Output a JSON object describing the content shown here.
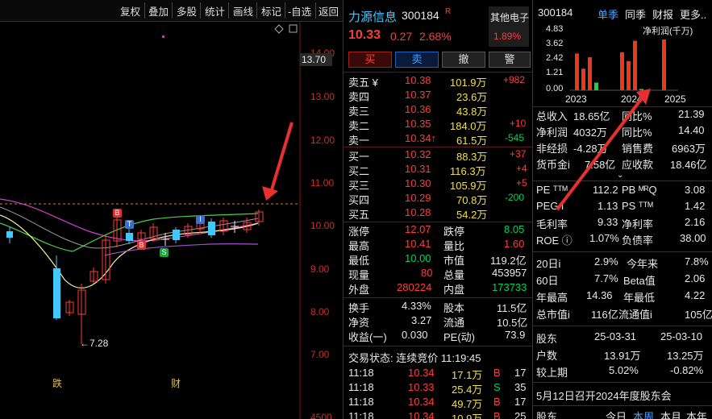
{
  "toolbar": {
    "items": [
      "复权",
      "叠加",
      "多股",
      "统计",
      "画线",
      "标记",
      "-自选",
      "返回"
    ]
  },
  "chart": {
    "price_labels": [
      "14.00",
      "13.00",
      "12.00",
      "11.00",
      "10.00",
      "9.00",
      "8.00",
      "7.00",
      "4500"
    ],
    "current_price_tag": "13.70",
    "low_label": "←7.28",
    "markers": {
      "b1": "B",
      "b2": "B",
      "t": "T",
      "i": "I",
      "s": "S"
    },
    "bottom_labels": [
      "跌",
      "财"
    ]
  },
  "quote": {
    "name": "力源信息",
    "code": "300184",
    "code_badge": "R",
    "sector": "其他电子",
    "sector_change": "1.89%",
    "price": "10.33",
    "change": "0.27",
    "change_pct": "2.68%",
    "buttons": [
      "买",
      "卖",
      "撤",
      "警"
    ],
    "asks": [
      {
        "label": "卖五 ¥",
        "price": "10.38",
        "vol": "101.9万",
        "delta": "+982",
        "delta_color": "red"
      },
      {
        "label": "卖四",
        "price": "10.37",
        "vol": "23.6万",
        "delta": "",
        "delta_color": "red"
      },
      {
        "label": "卖三",
        "price": "10.36",
        "vol": "43.8万",
        "delta": "",
        "delta_color": "red"
      },
      {
        "label": "卖二",
        "price": "10.35",
        "vol": "184.0万",
        "delta": "+10",
        "delta_color": "red"
      },
      {
        "label": "卖一",
        "price": "10.34↑",
        "vol": "61.5万",
        "delta": "-545",
        "delta_color": "green"
      }
    ],
    "bids": [
      {
        "label": "买一",
        "price": "10.32",
        "vol": "88.3万",
        "delta": "+37",
        "delta_color": "red"
      },
      {
        "label": "买二",
        "price": "10.31",
        "vol": "116.3万",
        "delta": "+4",
        "delta_color": "red"
      },
      {
        "label": "买三",
        "price": "10.30",
        "vol": "105.9万",
        "delta": "+5",
        "delta_color": "red"
      },
      {
        "label": "买四",
        "price": "10.29",
        "vol": "70.8万",
        "delta": "-200",
        "delta_color": "green"
      },
      {
        "label": "买五",
        "price": "10.28",
        "vol": "54.2万",
        "delta": "",
        "delta_color": "red"
      }
    ],
    "stats": [
      {
        "l1": "涨停",
        "v1": "12.07",
        "c1": "red",
        "l2": "跌停",
        "v2": "8.05",
        "c2": "green"
      },
      {
        "l1": "最高",
        "v1": "10.41",
        "c1": "red",
        "l2": "量比",
        "v2": "1.60",
        "c2": "red"
      },
      {
        "l1": "最低",
        "v1": "10.00",
        "c1": "green",
        "l2": "市值",
        "v2": "119.2亿",
        "c2": "white"
      },
      {
        "l1": "现量",
        "v1": "80",
        "c1": "red",
        "l2": "总量",
        "v2": "453957",
        "c2": "white"
      },
      {
        "l1": "外盘",
        "v1": "280224",
        "c1": "red",
        "l2": "内盘",
        "v2": "173733",
        "c2": "green"
      }
    ],
    "stats2": [
      {
        "l1": "换手",
        "v1": "4.33%",
        "l2": "股本",
        "v2": "11.5亿"
      },
      {
        "l1": "净资",
        "v1": "3.27",
        "l2": "流通",
        "v2": "10.5亿"
      },
      {
        "l1": "收益(一)",
        "v1": "0.030",
        "l2": "PE(动)",
        "v2": "73.9"
      }
    ],
    "trade_status": "交易状态: 连续竞价 11:19:45",
    "ticks": [
      {
        "time": "11:18",
        "price": "10.34",
        "vol": "17.1万",
        "side": "B",
        "side_color": "red",
        "n": "17"
      },
      {
        "time": "11:18",
        "price": "10.33",
        "vol": "25.4万",
        "side": "S",
        "side_color": "green",
        "n": "35"
      },
      {
        "time": "11:18",
        "price": "10.34",
        "vol": "49.7万",
        "side": "B",
        "side_color": "red",
        "n": "17"
      },
      {
        "time": "11:18",
        "price": "10.34",
        "vol": "10.9万",
        "side": "B",
        "side_color": "red",
        "n": "25"
      }
    ]
  },
  "fin": {
    "code": "300184",
    "tabs": [
      "单季",
      "同季",
      "财报",
      "更多.."
    ],
    "mini_chart": {
      "title": "净利润(千万)",
      "y_labels": [
        "4.83",
        "3.62",
        "2.42",
        "1.21",
        "0.00"
      ],
      "x_labels": [
        "2023",
        "2024",
        "2025"
      ]
    },
    "chart_data": {
      "type": "bar",
      "title": "净利润(千万)",
      "ylabel": "",
      "ylim": [
        0,
        4.83
      ],
      "x": [
        "2023",
        "2024",
        "2025"
      ],
      "series": [
        {
          "values": [
            2.9,
            1.7,
            2.6,
            0.6
          ]
        },
        {
          "values": [
            3.0,
            2.3,
            3.9,
            0.1
          ]
        },
        {
          "values": [
            4.0
          ]
        }
      ]
    },
    "rows": [
      {
        "l1": "总收入",
        "v1": "18.65亿",
        "l2": "同比%",
        "v2": "21.39",
        "c2": "white"
      },
      {
        "l1": "净利润",
        "v1": "4032万",
        "l2": "同比%",
        "v2": "14.40",
        "c2": "white"
      },
      {
        "l1": "非经损",
        "v1": "-4.28万",
        "l2": "销售费",
        "v2": "6963万",
        "c2": "white"
      },
      {
        "l1": "货币金i",
        "v1": "7.58亿",
        "l2": "应收款",
        "v2": "18.46亿",
        "c2": "white"
      }
    ],
    "rows2": [
      {
        "l1": "PE ᵀᵀᴹ",
        "v1": "112.2",
        "l2": "PB ᴹᴿQ",
        "v2": "3.08"
      },
      {
        "l1": "PEG i",
        "v1": "1.13",
        "l2": "PS ᵀᵀᴹ",
        "v2": "1.42"
      },
      {
        "l1": "毛利率",
        "v1": "9.33",
        "l2": "净利率",
        "v2": "2.16"
      },
      {
        "l1": "ROE ⓘ",
        "v1": "1.07%",
        "l2": "负债率",
        "v2": "38.00"
      }
    ],
    "rows3": [
      {
        "l1": "20日i",
        "v1": "2.9%",
        "l2": "今年来",
        "v2": "7.8%"
      },
      {
        "l1": "60日",
        "v1": "7.7%",
        "l2": "Beta值",
        "v2": "2.06"
      },
      {
        "l1": "年最高",
        "v1": "14.36",
        "l2": "年最低",
        "v2": "4.22"
      },
      {
        "l1": "总市值i",
        "v1": "116亿",
        "l2": "流通值i",
        "v2": "105亿"
      }
    ],
    "holders": [
      {
        "l": "股东",
        "v1": "25-03-31",
        "v2": "25-03-10"
      },
      {
        "l": "户数",
        "v1": "13.91万",
        "v2": "13.25万"
      },
      {
        "l": "较上期",
        "v1": "5.02%",
        "v2": "-0.82%"
      }
    ],
    "notice": "5月12日召开2024年度股东会",
    "bottom_tabs": [
      "股东",
      "今日",
      "本周",
      "本月",
      "本年"
    ]
  }
}
